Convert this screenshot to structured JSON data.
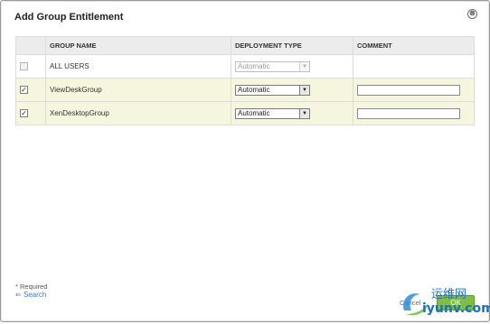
{
  "dialog": {
    "title": "Add Group Entitlement",
    "close_glyph": "⊗"
  },
  "table": {
    "headers": [
      "GROUP NAME",
      "DEPLOYMENT TYPE",
      "COMMENT"
    ],
    "rows": [
      {
        "checked": false,
        "check_glyph": "",
        "group": "ALL USERS",
        "deployment": "Automatic",
        "arrow": "▼",
        "enabled": false
      },
      {
        "checked": true,
        "check_glyph": "✓",
        "group": "ViewDeskGroup",
        "deployment": "Automatic",
        "arrow": "▼",
        "enabled": true
      },
      {
        "checked": true,
        "check_glyph": "✓",
        "group": "XenDesktopGroup",
        "deployment": "Automatic",
        "arrow": "▼",
        "enabled": true
      }
    ]
  },
  "footer": {
    "required_star": "*",
    "required_label": "Required",
    "search_arrow": "⇐",
    "search_label": "Search",
    "cancel_label": "Cancel",
    "ok_label": "OK"
  },
  "watermark": {
    "cn": "运维网",
    "url": "iyunv.com"
  },
  "colors": {
    "selected_row": "#f6f5dd",
    "header_bg": "#ececec",
    "link": "#3a7bbf",
    "ok_button": "#7fbf3f"
  }
}
